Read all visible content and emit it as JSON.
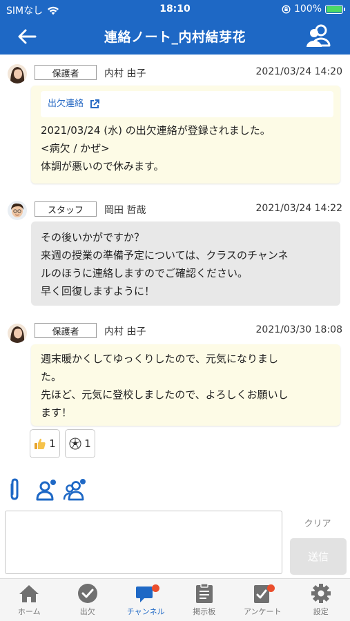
{
  "status_bar": {
    "carrier": "SIMなし",
    "time": "18:10",
    "battery": "100%"
  },
  "header": {
    "title": "連絡ノート_内村結芽花"
  },
  "messages": [
    {
      "role": "保護者",
      "sender": "内村 由子",
      "timestamp": "2021/03/24 14:20",
      "link_label": "出欠連絡",
      "lines": [
        "2021/03/24 (水) の出欠連絡が登録されました。",
        "<病欠 / かぜ>",
        "体調が悪いので休みます。"
      ]
    },
    {
      "role": "スタッフ",
      "sender": "岡田 哲哉",
      "timestamp": "2021/03/24 14:22",
      "lines": [
        "その後いかがですか？",
        "来週の授業の準備予定については、クラスのチャンネ",
        "ルのほうに連絡しますのでご確認ください。",
        "早く回復しますように！"
      ]
    },
    {
      "role": "保護者",
      "sender": "内村 由子",
      "timestamp": "2021/03/30 18:08",
      "lines": [
        "週末暖かくしてゆっくりしたので、元気になりまし",
        "た。",
        "先ほど、元気に登校しましたので、よろしくお願いし",
        "ます！"
      ]
    }
  ],
  "reactions": [
    {
      "icon": "thumbs-up",
      "count": "1"
    },
    {
      "icon": "soccer-ball",
      "count": "1"
    }
  ],
  "composer": {
    "clear_label": "クリア",
    "send_label": "送信"
  },
  "tabs": [
    {
      "label": "ホーム",
      "icon": "home-icon"
    },
    {
      "label": "出欠",
      "icon": "check-circle-icon"
    },
    {
      "label": "チャンネル",
      "icon": "chat-icon",
      "active": true,
      "badge": true
    },
    {
      "label": "掲示板",
      "icon": "clipboard-icon"
    },
    {
      "label": "アンケート",
      "icon": "survey-icon",
      "badge": true
    },
    {
      "label": "設定",
      "icon": "gear-icon"
    }
  ],
  "colors": {
    "primary": "#1e68c5",
    "parent_bubble": "#fdfbe6",
    "staff_bubble": "#e8e8e8",
    "badge": "#ea4e2c"
  }
}
